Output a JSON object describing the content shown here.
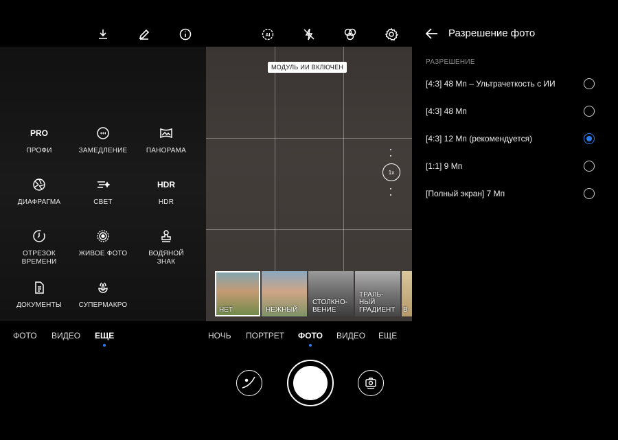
{
  "left": {
    "modes": [
      {
        "icon": "pro-text",
        "icon_text": "PRO",
        "label": "ПРОФИ"
      },
      {
        "icon": "slow-motion-icon",
        "label": "ЗАМЕДЛЕНИЕ"
      },
      {
        "icon": "panorama-icon",
        "label": "ПАНОРАМА"
      },
      {
        "icon": "aperture-icon",
        "label": "ДИАФРАГМА"
      },
      {
        "icon": "light-painting-icon",
        "label": "СВЕТ"
      },
      {
        "icon": "hdr-text",
        "icon_text": "HDR",
        "label": "HDR"
      },
      {
        "icon": "time-lapse-icon",
        "label": "ОТРЕЗОК\nВРЕМЕНИ"
      },
      {
        "icon": "live-photo-icon",
        "label": "ЖИВОЕ ФОТО"
      },
      {
        "icon": "watermark-icon",
        "label": "ВОДЯНОЙ\nЗНАК"
      },
      {
        "icon": "document-icon",
        "label": "ДОКУМЕНТЫ"
      },
      {
        "icon": "super-macro-icon",
        "label": "СУПЕРМАКРО"
      }
    ],
    "tabs": [
      "ФОТО",
      "ВИДЕО",
      "ЕЩЕ"
    ],
    "active_tab": "ЕЩЕ"
  },
  "middle": {
    "ai_badge": "МОДУЛЬ ИИ ВКЛЮЧЕН",
    "zoom": "1x",
    "filters": [
      {
        "label": "НЕТ",
        "selected": true
      },
      {
        "label": "НЕЖНЫЙ",
        "selected": false
      },
      {
        "label": "СТОЛКНО-\nВЕНИЕ",
        "selected": false
      },
      {
        "label": "ТРАЛЬ-\nНЫЙ\nГРАДИЕНТ",
        "selected": false
      },
      {
        "label": "В",
        "selected": false
      }
    ],
    "tabs": [
      "НОЧЬ",
      "ПОРТРЕТ",
      "ФОТО",
      "ВИДЕО",
      "ЕЩЕ"
    ],
    "active_tab": "ФОТО"
  },
  "right": {
    "title": "Разрешение фото",
    "section": "РАЗРЕШЕНИЕ",
    "options": [
      {
        "label": "[4:3] 48 Мп – Ультрачеткость с ИИ",
        "selected": false
      },
      {
        "label": "[4:3] 48 Мп",
        "selected": false
      },
      {
        "label": "[4:3] 12 Мп (рекомендуется)",
        "selected": true
      },
      {
        "label": "[1:1] 9 Мп",
        "selected": false
      },
      {
        "label": "[Полный экран] 7 Мп",
        "selected": false
      }
    ]
  },
  "colors": {
    "accent": "#2a7df0",
    "background": "#000000"
  }
}
